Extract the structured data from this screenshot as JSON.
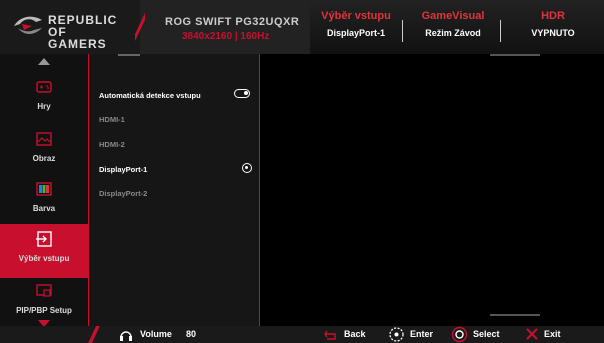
{
  "header": {
    "brand_line1": "REPUBLIC OF",
    "brand_line2": "GAMERS",
    "model": "ROG SWIFT PG32UQXR",
    "resolution": "3840x2160 | 160Hz",
    "input": {
      "title": "Výběr vstupu",
      "value": "DisplayPort-1"
    },
    "gamevisual": {
      "title": "GameVisual",
      "value": "Režim Závod"
    },
    "hdr": {
      "title": "HDR",
      "value": "VYPNUTO"
    }
  },
  "sidebar": {
    "items": [
      {
        "label": "Hry",
        "icon": "gamepad-icon"
      },
      {
        "label": "Obraz",
        "icon": "image-icon"
      },
      {
        "label": "Barva",
        "icon": "color-icon"
      },
      {
        "label": "Výběr vstupu",
        "icon": "input-select-icon",
        "active": true
      },
      {
        "label": "PIP/PBP Setup",
        "icon": "pip-icon"
      }
    ]
  },
  "panel": {
    "options": [
      {
        "label": "Automatická detekce vstupu",
        "control": "toggle",
        "state": "on"
      },
      {
        "label": "HDMI-1",
        "control": "none",
        "enabled": false
      },
      {
        "label": "HDMI-2",
        "control": "none",
        "enabled": false
      },
      {
        "label": "DisplayPort-1",
        "control": "radio",
        "selected": true,
        "enabled": true
      },
      {
        "label": "DisplayPort-2",
        "control": "none",
        "enabled": false
      }
    ]
  },
  "footer": {
    "volume_label": "Volume",
    "volume_value": "80",
    "back": "Back",
    "enter": "Enter",
    "select": "Select",
    "exit": "Exit"
  },
  "colors": {
    "accent": "#c8102e",
    "background": "#000000",
    "panel": "#161616"
  }
}
